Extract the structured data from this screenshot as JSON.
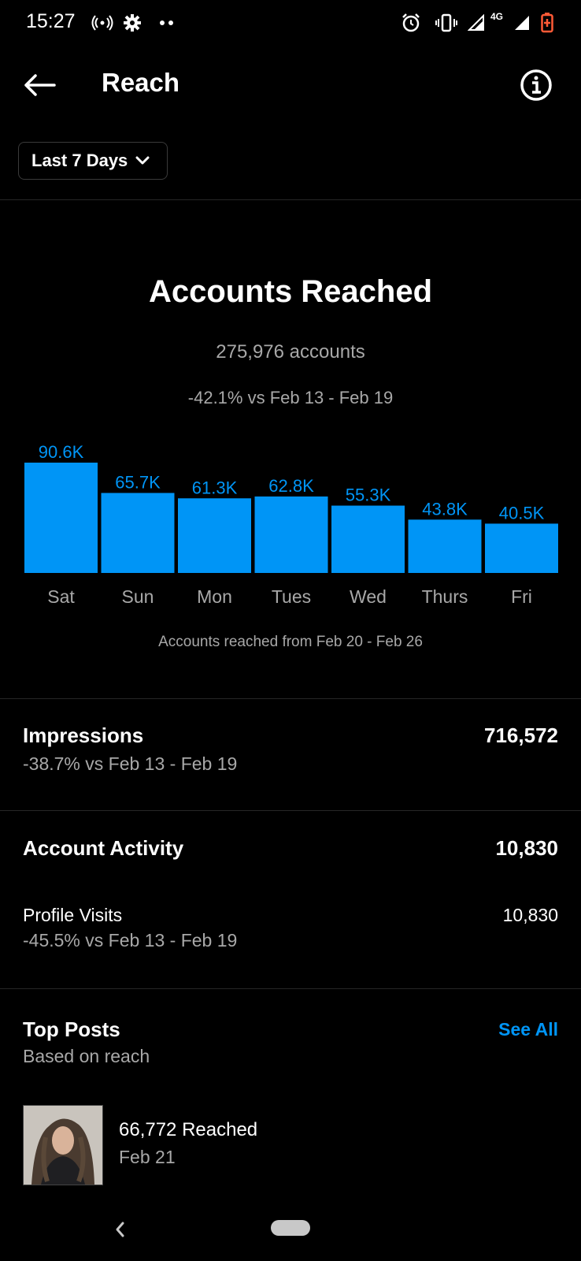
{
  "status_bar": {
    "time": "15:27",
    "network_label": "4G",
    "icons": [
      "hotspot-icon",
      "gear-icon",
      "more-dots-icon",
      "alarm-icon",
      "vibrate-icon",
      "signal-icon",
      "signal-icon",
      "battery-icon"
    ]
  },
  "header": {
    "title": "Reach",
    "back_icon": "arrow-left-icon",
    "info_icon": "info-icon"
  },
  "range": {
    "label": "Last 7 Days"
  },
  "accounts_reached": {
    "title": "Accounts Reached",
    "count": "275,976 accounts",
    "change": "-42.1% vs Feb 13 - Feb 19",
    "caption": "Accounts reached from Feb 20 - Feb 26"
  },
  "chart_data": {
    "type": "bar",
    "categories": [
      "Sat",
      "Sun",
      "Mon",
      "Tues",
      "Wed",
      "Thurs",
      "Fri"
    ],
    "values": [
      90.6,
      65.7,
      61.3,
      62.8,
      55.3,
      43.8,
      40.5
    ],
    "value_labels": [
      "90.6K",
      "65.7K",
      "61.3K",
      "62.8K",
      "55.3K",
      "43.8K",
      "40.5K"
    ],
    "ylim": [
      0,
      90.6
    ],
    "bar_color": "#0095f6",
    "label_color": "#0095f6",
    "grid": false
  },
  "impressions": {
    "label": "Impressions",
    "value": "716,572",
    "change": "-38.7% vs Feb 13 - Feb 19"
  },
  "account_activity": {
    "label": "Account Activity",
    "value": "10,830",
    "profile_visits_label": "Profile Visits",
    "profile_visits_value": "10,830",
    "profile_visits_change": "-45.5% vs Feb 13 - Feb 19"
  },
  "top_posts": {
    "title": "Top Posts",
    "subtitle": "Based on reach",
    "see_all": "See All",
    "posts": [
      {
        "reached": "66,772 Reached",
        "date": "Feb 21"
      }
    ]
  },
  "colors": {
    "background": "#000000",
    "accent": "#0095f6",
    "secondary_text": "#a8a8a8"
  }
}
